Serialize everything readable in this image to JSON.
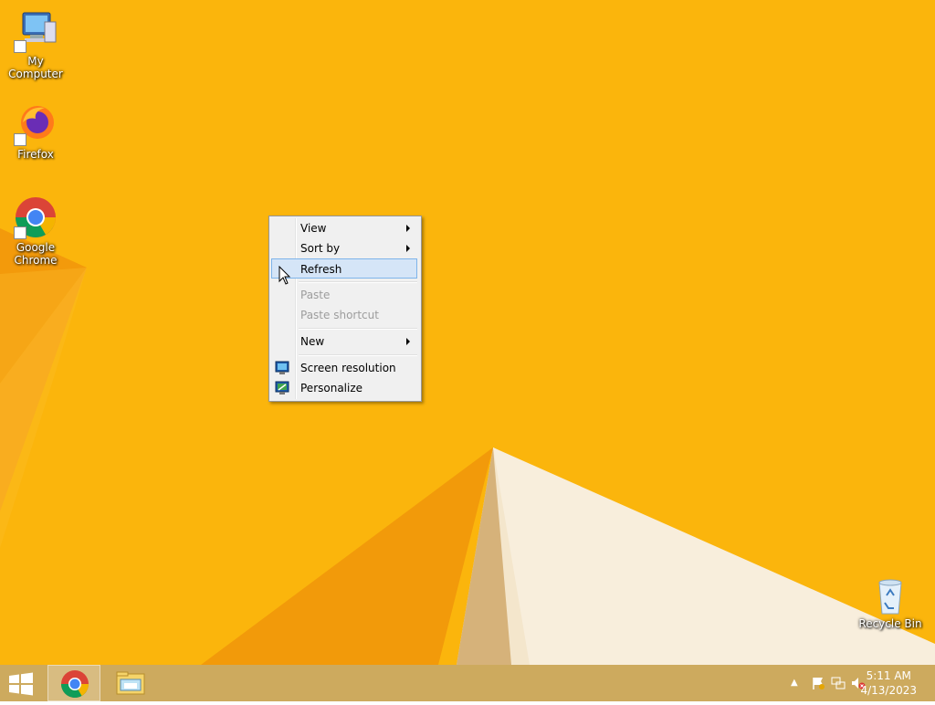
{
  "desktop": {
    "icons": [
      {
        "label": "My Computer",
        "icon": "computer-icon"
      },
      {
        "label": "Firefox",
        "icon": "firefox-icon"
      },
      {
        "label": "Google Chrome",
        "icon": "chrome-icon"
      },
      {
        "label": "Recycle Bin",
        "icon": "recycle-bin-icon"
      }
    ]
  },
  "context_menu": {
    "items": [
      {
        "label": "View",
        "submenu": true,
        "state": "normal"
      },
      {
        "label": "Sort by",
        "submenu": true,
        "state": "normal"
      },
      {
        "label": "Refresh",
        "submenu": false,
        "state": "hover"
      },
      {
        "label": "Paste",
        "submenu": false,
        "state": "disabled"
      },
      {
        "label": "Paste shortcut",
        "submenu": false,
        "state": "disabled"
      },
      {
        "label": "New",
        "submenu": true,
        "state": "normal"
      },
      {
        "label": "Screen resolution",
        "submenu": false,
        "state": "normal",
        "icon": "screen-resolution-icon"
      },
      {
        "label": "Personalize",
        "submenu": false,
        "state": "normal",
        "icon": "personalize-icon"
      }
    ]
  },
  "taskbar": {
    "start_icon": "windows-logo-icon",
    "pinned": [
      {
        "name": "Google Chrome",
        "icon": "chrome-icon",
        "active": true
      },
      {
        "name": "File Explorer",
        "icon": "file-explorer-icon",
        "active": false
      }
    ],
    "tray": {
      "icons": [
        "show-hidden-icons-chevron",
        "action-center-flag-icon",
        "network-icon",
        "volume-muted-icon"
      ],
      "time": "5:11 AM",
      "date": "4/13/2023"
    }
  },
  "colors": {
    "wallpaper": "#FBB50C",
    "menu_hover": "#D5E5F7",
    "menu_hover_border": "#7EB4EA",
    "taskbar": "#CDAA5E"
  }
}
